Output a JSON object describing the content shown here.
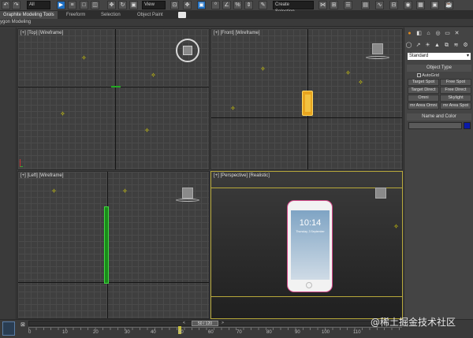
{
  "toolbar": {
    "select_filter": "All",
    "view_dropdown": "View",
    "selection_set": "Create Selection..."
  },
  "ribbon": {
    "tabs": [
      "Graphite Modeling Tools",
      "Freeform",
      "Selection",
      "Object Paint"
    ],
    "sub_label": "ygon Modeling"
  },
  "viewports": {
    "top": {
      "label": "[+] [Top] [Wireframe]"
    },
    "front": {
      "label": "[+] [Front] [Wireframe]"
    },
    "left": {
      "label": "[+] [Left] [Wireframe]"
    },
    "perspective": {
      "label": "[+] [Perspective] [Realistic]"
    }
  },
  "phone": {
    "time": "10:14",
    "date": "Thursday, 3 September"
  },
  "command_panel": {
    "category_dropdown": "Standard",
    "object_type_title": "Object Type",
    "autogrid_label": "AutoGrid",
    "buttons": [
      "Target Spot",
      "Free Spot",
      "Target Direct",
      "Free Direct",
      "Omni",
      "Skylight",
      "mr Area Omni",
      "mr Area Spot"
    ],
    "name_color_title": "Name and Color",
    "color_swatch": "#0a1aa8"
  },
  "timeline": {
    "frame_counter": "50 / 120",
    "ticks": [
      "0",
      "10",
      "20",
      "30",
      "40",
      "50",
      "60",
      "70",
      "80",
      "90",
      "100",
      "110"
    ]
  },
  "watermark": "@稀土掘金技术社区",
  "colors": {
    "accent": "#1e6fc2",
    "light": "#e8e000",
    "selection": "#b7a83a"
  }
}
